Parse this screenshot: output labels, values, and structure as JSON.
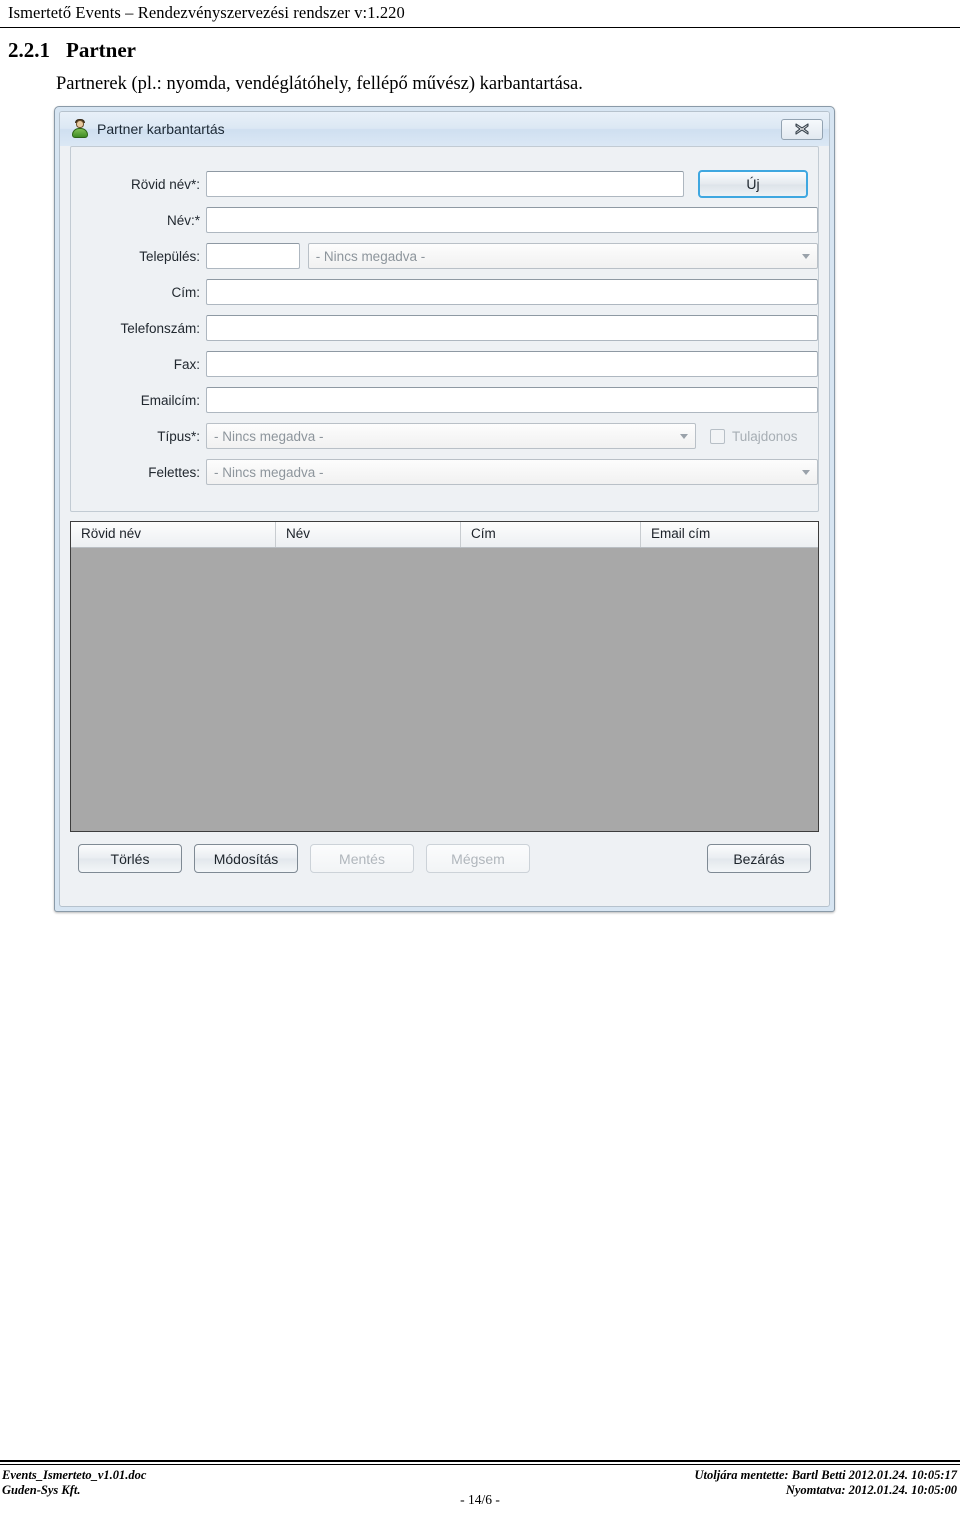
{
  "document": {
    "header_text": "Ismertető Events – Rendezvényszervezési rendszer v:1.220",
    "section_number": "2.2.1",
    "section_title": "Partner",
    "section_body": "Partnerek (pl.: nyomda, vendéglátóhely, fellépő művész) karbantartása."
  },
  "window": {
    "title": "Partner karbantartás",
    "title_icon": "user-icon",
    "close_icon": "close-icon",
    "form": {
      "fields": [
        {
          "label": "Rövid név*:",
          "value": "",
          "type": "text"
        },
        {
          "label": "Név:*",
          "value": "",
          "type": "text"
        },
        {
          "label": "Település:",
          "value": "",
          "type": "text-plus-combo",
          "combo_value": "- Nincs megadva -"
        },
        {
          "label": "Cím:",
          "value": "",
          "type": "text"
        },
        {
          "label": "Telefonszám:",
          "value": "",
          "type": "text"
        },
        {
          "label": "Fax:",
          "value": "",
          "type": "text"
        },
        {
          "label": "Emailcím:",
          "value": "",
          "type": "text"
        },
        {
          "label": "Típus*:",
          "value": "- Nincs megadva -",
          "type": "combo"
        },
        {
          "label": "Felettes:",
          "value": "- Nincs megadva -",
          "type": "combo"
        }
      ],
      "new_button_label": "Új",
      "owner_checkbox_label": "Tulajdonos",
      "owner_checkbox_checked": false,
      "owner_checkbox_disabled": true
    },
    "grid": {
      "columns": [
        "Rövid név",
        "Név",
        "Cím",
        "Email cím"
      ],
      "rows": []
    },
    "buttons": [
      {
        "label": "Törlés",
        "enabled": true
      },
      {
        "label": "Módosítás",
        "enabled": true
      },
      {
        "label": "Mentés",
        "enabled": false
      },
      {
        "label": "Mégsem",
        "enabled": false
      },
      {
        "label": "Bezárás",
        "enabled": true
      }
    ]
  },
  "footer": {
    "file_name": "Events_Ismerteto_v1.01.doc",
    "company": "Guden-Sys Kft.",
    "last_saved": "Utoljára mentette: Bartl Betti  2012.01.24.   10:05:17",
    "printed": "Nyomtatva: 2012.01.24.  10:05:00",
    "page": "- 14/6 -"
  },
  "colors": {
    "focus_accent": "#3fa7e0",
    "window_frame": "#d7e5f2",
    "grid_body": "#a8a8a8"
  }
}
